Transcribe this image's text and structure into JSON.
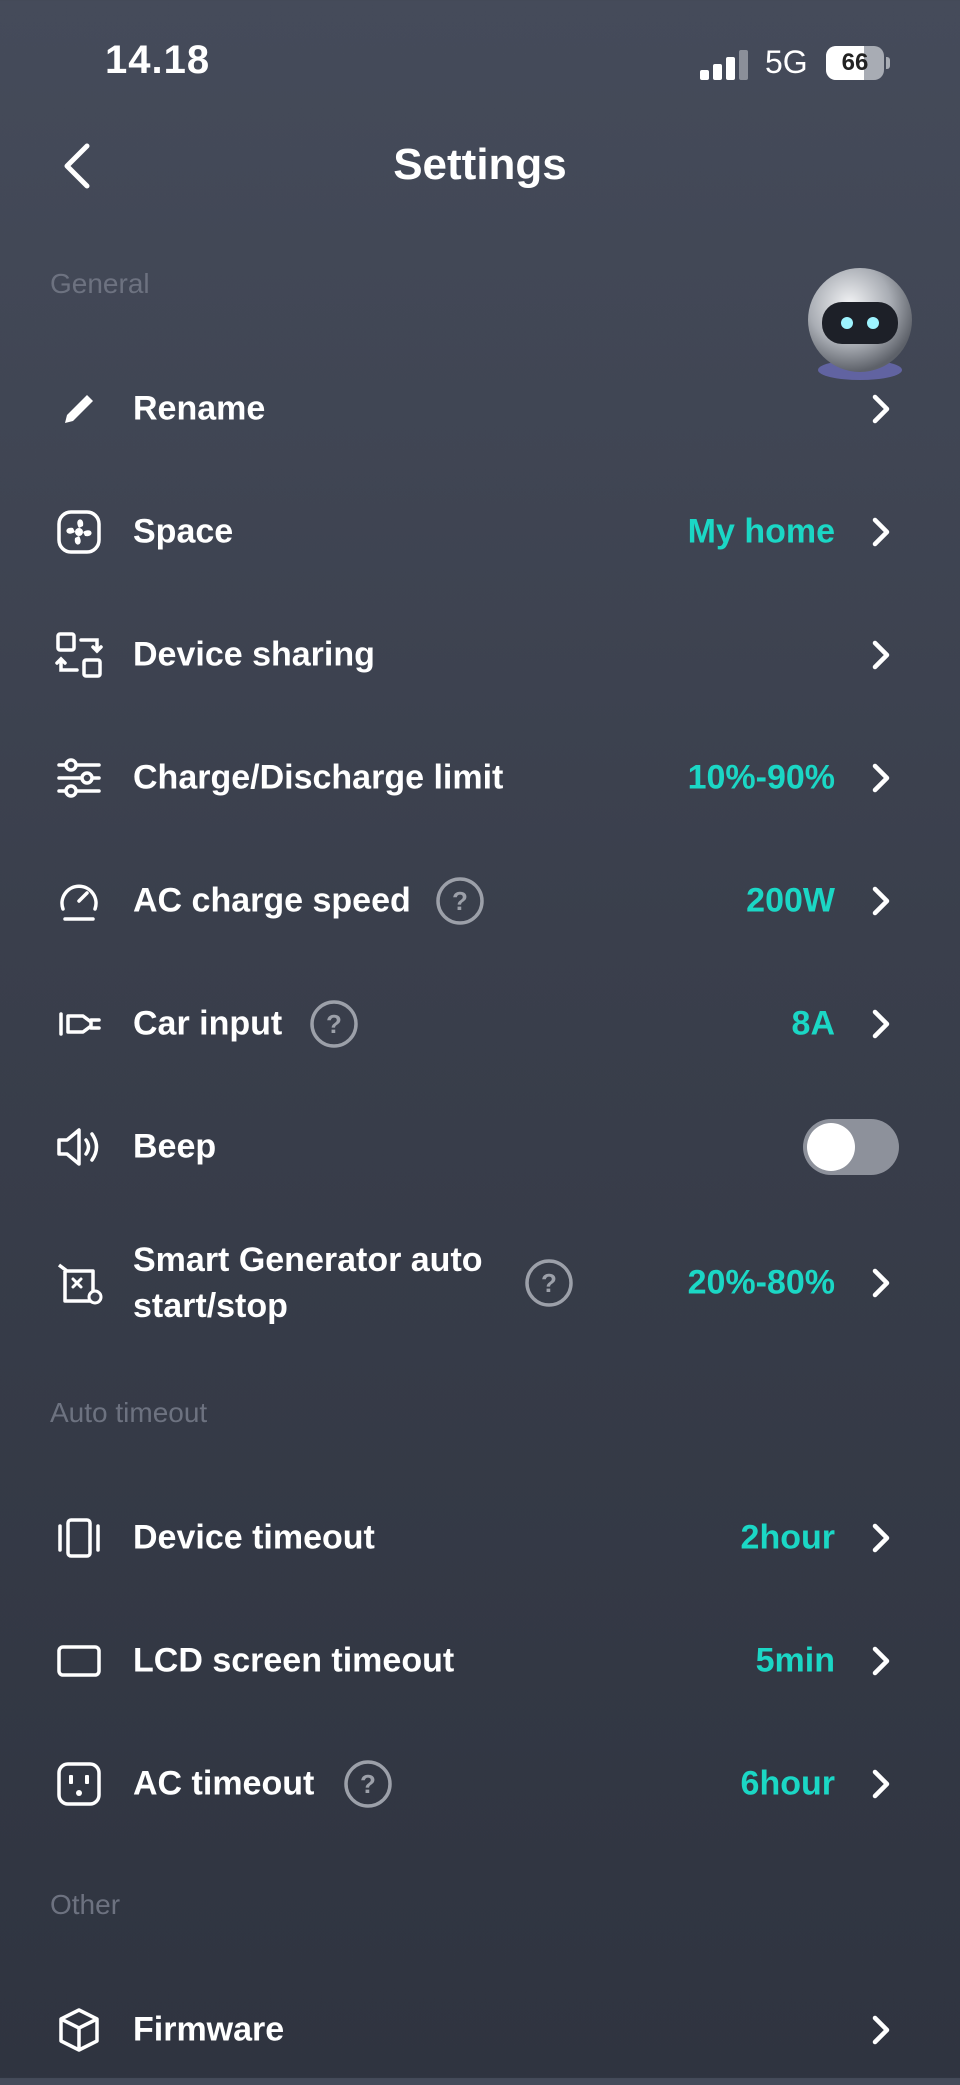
{
  "status_bar": {
    "time": "14.18",
    "network": "5G",
    "battery": "66",
    "battery_level": 0.66
  },
  "header": {
    "title": "Settings"
  },
  "sections": {
    "general": "General",
    "auto_timeout": "Auto timeout",
    "other": "Other"
  },
  "rows": {
    "rename": {
      "label": "Rename",
      "icon": "pencil-icon"
    },
    "space": {
      "label": "Space",
      "value": "My home",
      "icon": "fan-icon"
    },
    "device_sharing": {
      "label": "Device sharing",
      "icon": "share-icon"
    },
    "charge_limit": {
      "label": "Charge/Discharge limit",
      "value": "10%-90%",
      "icon": "sliders-icon"
    },
    "ac_charge_speed": {
      "label": "AC charge speed",
      "value": "200W",
      "icon": "speedometer-icon"
    },
    "car_input": {
      "label": "Car input",
      "value": "8A",
      "icon": "car-plug-icon"
    },
    "beep": {
      "label": "Beep",
      "icon": "speaker-icon",
      "enabled": false
    },
    "smart_generator": {
      "label_line1": "Smart Generator auto",
      "label_line2": "start/stop",
      "value": "20%-80%",
      "icon": "generator-icon"
    },
    "device_timeout": {
      "label": "Device timeout",
      "value": "2hour",
      "icon": "device-icon"
    },
    "lcd_timeout": {
      "label": "LCD screen timeout",
      "value": "5min",
      "icon": "screen-icon"
    },
    "ac_timeout": {
      "label": "AC timeout",
      "value": "6hour",
      "icon": "ac-outlet-icon"
    },
    "firmware": {
      "label": "Firmware",
      "icon": "cube-icon"
    }
  },
  "colors": {
    "accent": "#1bd7c5",
    "background": "#3a3f4c",
    "section_label": "#6d7280"
  }
}
